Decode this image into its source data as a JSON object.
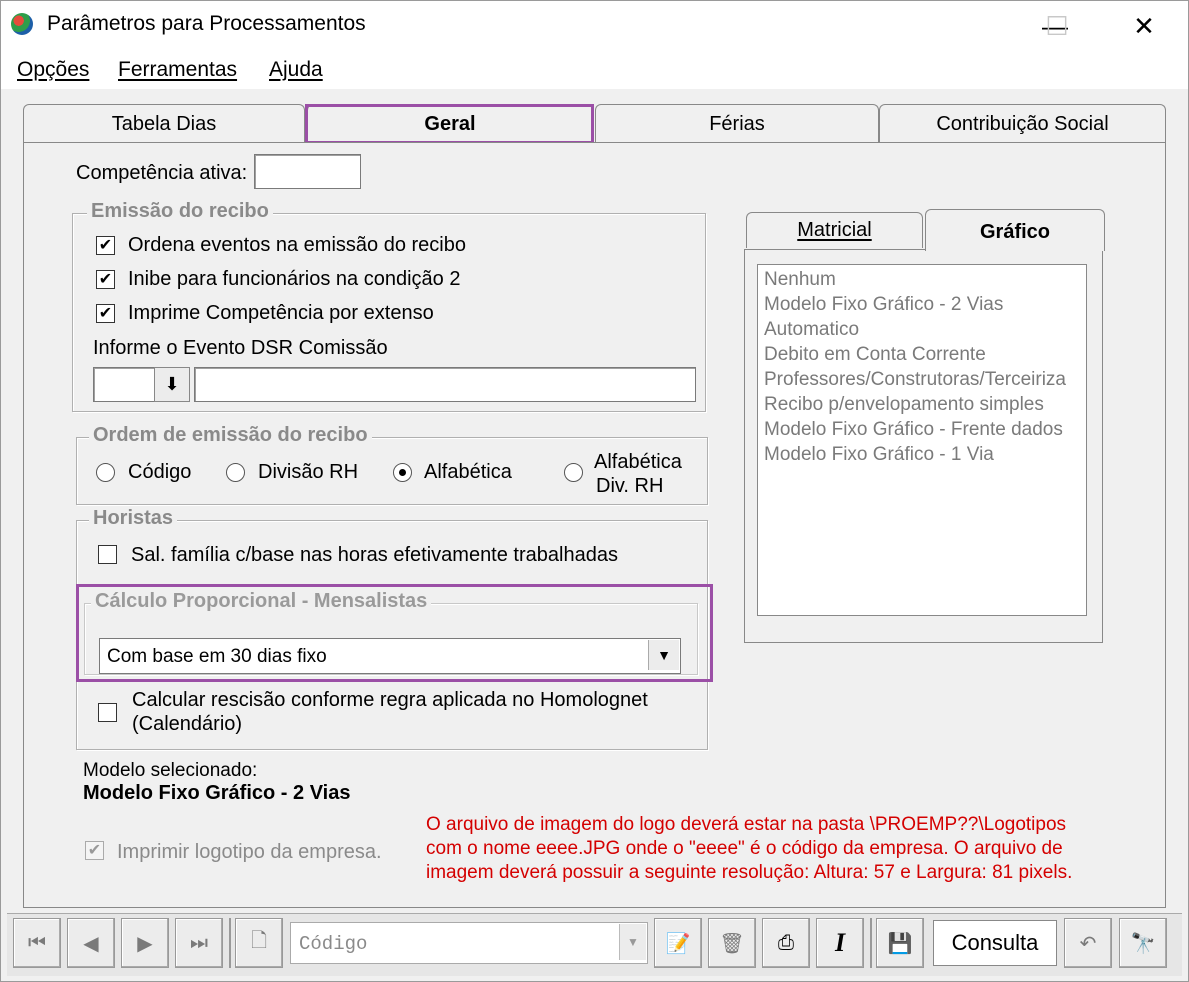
{
  "window": {
    "title": "Parâmetros para Processamentos",
    "minimize": "—",
    "maximize": "☐",
    "close": "✕"
  },
  "menu": [
    "Opções",
    "Ferramentas",
    "Ajuda"
  ],
  "tabs": [
    "Tabela Dias",
    "Geral",
    "Férias",
    "Contribuição Social"
  ],
  "active_tab": "Geral",
  "competencia": {
    "label": "Competência ativa:",
    "value": ""
  },
  "emissao": {
    "title": "Emissão do recibo",
    "checks": [
      {
        "label": "Ordena eventos na emissão do recibo",
        "checked": true
      },
      {
        "label": "Inibe para funcionários na condição 2",
        "checked": true
      },
      {
        "label": "Imprime Competência por extenso",
        "checked": true
      }
    ],
    "dsr_label": "Informe o Evento DSR Comissão",
    "dsr_code": "",
    "dsr_desc": "",
    "dsr_btn": "⬇"
  },
  "ordem": {
    "title": "Ordem de emissão do recibo",
    "options": [
      "Código",
      "Divisão RH",
      "Alfabética",
      "Alfabética Div. RH"
    ],
    "opt4_line1": "Alfabética",
    "opt4_line2": "Div.  RH",
    "selected": "Alfabética"
  },
  "horistas": {
    "title": "Horistas",
    "check": "Sal. família c/base nas horas efetivamente trabalhadas",
    "checked": false
  },
  "proporcional": {
    "title": "Cálculo Proporcional - Mensalistas",
    "value": "Com base em 30 dias fixo"
  },
  "rescisao": {
    "line1": "Calcular rescisão conforme regra aplicada no Homolognet",
    "line2": "(Calendário)",
    "checked": false
  },
  "modelo": {
    "label": "Modelo selecionado:",
    "value": "Modelo Fixo Gráfico - 2 Vias"
  },
  "logotipo": {
    "label": "Imprimir logotipo da empresa.",
    "checked": true
  },
  "warning": {
    "line1": "O arquivo de imagem do logo deverá estar na pasta \\PROEMP??\\Logotipos",
    "line2": "com o nome eeee.JPG onde o \"eeee\" é o código da empresa. O arquivo de",
    "line3": "imagem deverá possuir a seguinte resolução: Altura: 57 e Largura: 81 pixels.",
    "color": "#d40000"
  },
  "subtabs": [
    "Matricial",
    "Gráfico"
  ],
  "active_subtab": "Gráfico",
  "models": [
    "Nenhum",
    "Modelo Fixo Gráfico - 2 Vias",
    "Automatico",
    "Debito em Conta Corrente",
    "Professores/Construtoras/Terceiriza",
    "Recibo p/envelopamento simples",
    "Modelo Fixo Gráfico - Frente dados",
    "Modelo Fixo Gráfico - 1 Via"
  ],
  "navbar": {
    "combo_placeholder": "Código",
    "status": "Consulta"
  },
  "accent": "#9b4fa6"
}
